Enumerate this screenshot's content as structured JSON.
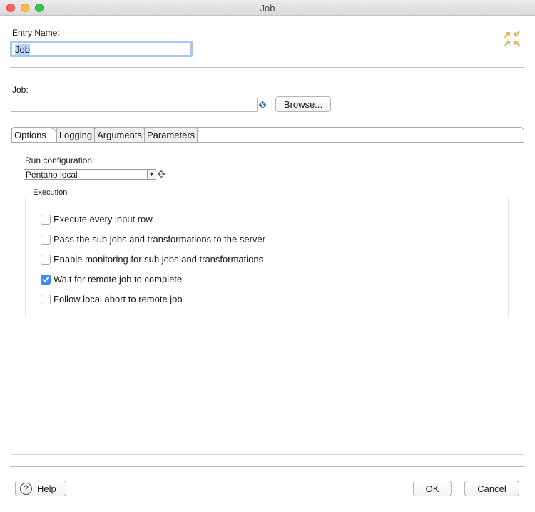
{
  "window": {
    "title": "Job"
  },
  "entry_name": {
    "label": "Entry Name:",
    "value": "Job"
  },
  "job": {
    "label": "Job:",
    "value": "",
    "browse_label": "Browse..."
  },
  "tabs": [
    {
      "label": "Options",
      "active": true
    },
    {
      "label": "Logging"
    },
    {
      "label": "Arguments"
    },
    {
      "label": "Parameters"
    }
  ],
  "options": {
    "run_config_label": "Run configuration:",
    "run_config_value": "Pentaho local",
    "execution_label": "Execution",
    "checkboxes": [
      {
        "label": "Execute every input row",
        "checked": false
      },
      {
        "label": "Pass the sub jobs and transformations to the server",
        "checked": false
      },
      {
        "label": "Enable monitoring for sub jobs and transformations",
        "checked": false
      },
      {
        "label": "Wait for remote job to complete",
        "checked": true
      },
      {
        "label": "Follow local abort to remote job",
        "checked": false
      }
    ]
  },
  "footer": {
    "help_label": "Help",
    "ok_label": "OK",
    "cancel_label": "Cancel"
  },
  "icons": {
    "corner": "expand-collapse-icon",
    "variable": "variable-dollar-icon",
    "help": "help-circle-icon"
  },
  "colors": {
    "accent": "#3b8ff6",
    "corner_icon": "#f0a030"
  }
}
